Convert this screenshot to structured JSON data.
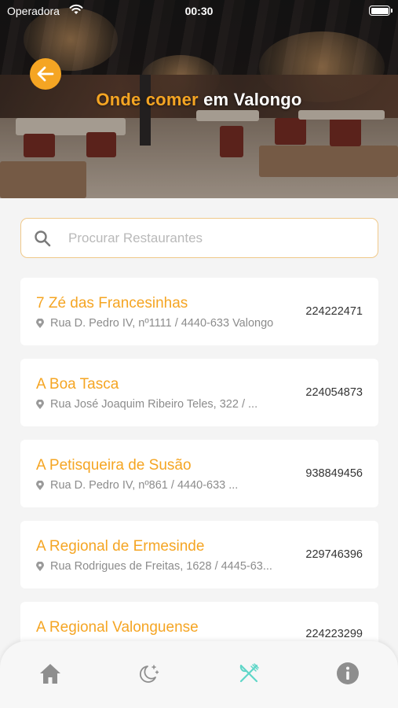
{
  "status_bar": {
    "carrier": "Operadora",
    "time": "00:30"
  },
  "header": {
    "title_accent": "Onde comer",
    "title_rest": " em Valongo",
    "back_icon": "arrow-left-icon",
    "accent_color": "#f5a523"
  },
  "search": {
    "placeholder": "Procurar Restaurantes",
    "icon": "search-icon"
  },
  "restaurants": [
    {
      "name": "7 Zé das Francesinhas",
      "address": "Rua D. Pedro IV, nº1111 / 4440-633 Valongo",
      "phone": "224222471"
    },
    {
      "name": "A Boa Tasca",
      "address": "Rua José Joaquim Ribeiro Teles, 322 / ...",
      "phone": "224054873"
    },
    {
      "name": "A Petisqueira de Susão",
      "address": "Rua D. Pedro IV, nº861 / 4440-633 ...",
      "phone": "938849456"
    },
    {
      "name": "A Regional de Ermesinde",
      "address": "Rua Rodrigues de Freitas, 1628 / 4445-63...",
      "phone": "229746396"
    },
    {
      "name": "A Regional Valonguense",
      "address": "",
      "phone": "224223299"
    }
  ],
  "tab_bar": {
    "tabs": [
      {
        "name": "home",
        "icon": "home-icon",
        "active": false
      },
      {
        "name": "night",
        "icon": "moon-stars-icon",
        "active": false
      },
      {
        "name": "restaurants",
        "icon": "fork-knife-icon",
        "active": true
      },
      {
        "name": "info",
        "icon": "info-icon",
        "active": false
      }
    ],
    "active_color": "#5fd6c8",
    "inactive_color": "#8e8e8e"
  }
}
